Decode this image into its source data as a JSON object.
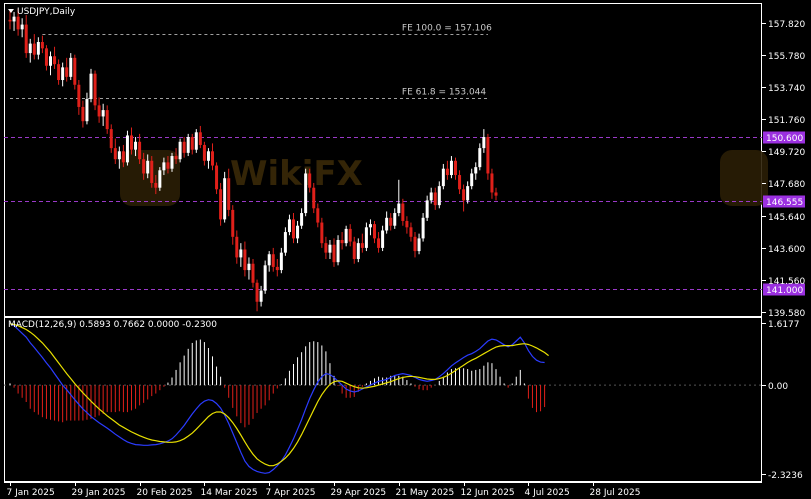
{
  "chart_data": [
    {
      "type": "candlestick",
      "title": "USDJPY,Daily",
      "title_prefix_icon": "triangle-down-icon",
      "ylim": [
        139.3,
        159.0
      ],
      "ytick_labels": [
        "157.820",
        "155.780",
        "153.740",
        "151.760",
        "149.720",
        "147.680",
        "145.640",
        "143.600",
        "141.560",
        "139.580"
      ],
      "ytick_values": [
        157.82,
        155.78,
        153.74,
        151.76,
        149.72,
        147.68,
        145.64,
        143.6,
        141.56,
        139.58
      ],
      "xtick_labels": [
        "7 Jan 2025",
        "29 Jan 2025",
        "20 Feb 2025",
        "14 Mar 2025",
        "7 Apr 2025",
        "29 Apr 2025",
        "21 May 2025",
        "12 Jun 2025",
        "4 Jul 2025",
        "28 Jul 2025"
      ],
      "xtick_index": [
        0,
        16,
        32,
        48,
        64,
        80,
        96,
        112,
        128,
        144
      ],
      "colors": {
        "bull": "#ffffff",
        "bear": "#e0201a",
        "level": "#9a39c8",
        "fib": "#a0a0a0",
        "label_bg": "#9b30e0"
      },
      "fib_levels": [
        {
          "text": "FE 100.0 = 157.106",
          "price": 157.106,
          "x_from_index": 8,
          "x_to_index": 118
        },
        {
          "text": "FE 61.8 = 153.044",
          "price": 153.044,
          "x_from_index": 0,
          "x_to_index": 118
        }
      ],
      "levels": [
        {
          "price": 150.6,
          "label": "150.600"
        },
        {
          "price": 146.555,
          "label": "146.555"
        },
        {
          "price": 141.0,
          "label": "141.000"
        }
      ],
      "ohlc": [
        [
          158.0,
          158.6,
          157.4,
          157.9
        ],
        [
          157.9,
          158.5,
          157.3,
          158.2
        ],
        [
          158.2,
          158.7,
          157.0,
          157.4
        ],
        [
          157.4,
          158.1,
          156.9,
          157.7
        ],
        [
          157.7,
          158.3,
          155.6,
          155.9
        ],
        [
          155.9,
          156.8,
          155.3,
          156.5
        ],
        [
          156.5,
          157.1,
          155.5,
          155.8
        ],
        [
          155.8,
          156.9,
          155.5,
          156.6
        ],
        [
          156.6,
          157.0,
          155.9,
          156.2
        ],
        [
          156.2,
          156.4,
          154.8,
          155.1
        ],
        [
          155.1,
          156.0,
          154.5,
          155.7
        ],
        [
          155.7,
          156.3,
          154.9,
          155.2
        ],
        [
          155.2,
          155.5,
          153.9,
          154.2
        ],
        [
          154.2,
          155.3,
          153.8,
          155.0
        ],
        [
          155.0,
          155.6,
          154.1,
          154.4
        ],
        [
          154.4,
          155.9,
          154.2,
          155.6
        ],
        [
          155.6,
          155.8,
          153.6,
          153.9
        ],
        [
          153.9,
          154.2,
          152.0,
          152.5
        ],
        [
          152.5,
          152.9,
          151.2,
          151.6
        ],
        [
          151.6,
          153.4,
          151.4,
          153.0
        ],
        [
          153.0,
          154.9,
          152.8,
          154.6
        ],
        [
          154.6,
          154.8,
          152.3,
          152.6
        ],
        [
          152.6,
          153.1,
          151.5,
          151.9
        ],
        [
          151.9,
          152.7,
          151.3,
          152.3
        ],
        [
          152.3,
          152.6,
          150.8,
          151.1
        ],
        [
          151.1,
          151.4,
          149.6,
          149.9
        ],
        [
          149.9,
          150.5,
          148.9,
          149.2
        ],
        [
          149.2,
          150.0,
          148.6,
          149.7
        ],
        [
          149.7,
          150.1,
          148.7,
          149.0
        ],
        [
          149.0,
          151.0,
          148.8,
          150.7
        ],
        [
          150.7,
          151.2,
          149.5,
          149.8
        ],
        [
          149.8,
          150.6,
          149.4,
          150.3
        ],
        [
          150.3,
          150.8,
          148.9,
          149.2
        ],
        [
          149.2,
          149.6,
          147.9,
          148.3
        ],
        [
          148.3,
          149.5,
          148.0,
          149.1
        ],
        [
          149.1,
          149.4,
          147.4,
          147.7
        ],
        [
          147.7,
          148.2,
          147.0,
          147.4
        ],
        [
          147.4,
          148.7,
          147.2,
          148.5
        ],
        [
          148.5,
          149.3,
          148.2,
          149.0
        ],
        [
          149.0,
          149.4,
          148.3,
          148.6
        ],
        [
          148.6,
          149.6,
          148.4,
          149.4
        ],
        [
          149.4,
          149.9,
          148.9,
          149.2
        ],
        [
          149.2,
          150.5,
          149.0,
          150.3
        ],
        [
          150.3,
          150.6,
          149.3,
          149.6
        ],
        [
          149.6,
          150.8,
          149.4,
          150.6
        ],
        [
          150.6,
          150.8,
          149.5,
          149.8
        ],
        [
          149.8,
          151.1,
          149.6,
          150.9
        ],
        [
          150.9,
          151.3,
          149.9,
          150.1
        ],
        [
          150.1,
          150.3,
          148.8,
          149.1
        ],
        [
          149.1,
          149.9,
          148.6,
          149.7
        ],
        [
          149.7,
          150.2,
          148.5,
          148.8
        ],
        [
          148.8,
          149.0,
          147.0,
          147.3
        ],
        [
          147.3,
          147.7,
          145.0,
          145.4
        ],
        [
          145.4,
          148.4,
          145.2,
          148.0
        ],
        [
          148.0,
          148.6,
          145.6,
          146.0
        ],
        [
          146.0,
          146.3,
          143.8,
          144.3
        ],
        [
          144.3,
          144.7,
          142.6,
          143.0
        ],
        [
          143.0,
          143.9,
          142.4,
          143.5
        ],
        [
          143.5,
          144.0,
          141.8,
          142.2
        ],
        [
          142.2,
          143.0,
          141.6,
          142.6
        ],
        [
          142.6,
          142.9,
          141.1,
          141.4
        ],
        [
          141.4,
          141.6,
          139.6,
          140.2
        ],
        [
          140.2,
          141.2,
          139.9,
          140.9
        ],
        [
          140.9,
          142.8,
          140.7,
          142.5
        ],
        [
          142.5,
          143.4,
          142.1,
          143.2
        ],
        [
          143.2,
          143.6,
          142.1,
          142.4
        ],
        [
          142.4,
          142.9,
          141.8,
          142.2
        ],
        [
          142.2,
          143.6,
          142.0,
          143.3
        ],
        [
          143.3,
          144.9,
          143.1,
          144.6
        ],
        [
          144.6,
          145.7,
          144.4,
          145.4
        ],
        [
          145.4,
          145.8,
          143.9,
          144.2
        ],
        [
          144.2,
          145.3,
          143.9,
          145.0
        ],
        [
          145.0,
          146.1,
          144.8,
          145.8
        ],
        [
          145.8,
          148.6,
          145.6,
          148.3
        ],
        [
          148.3,
          148.6,
          147.1,
          147.4
        ],
        [
          147.4,
          147.7,
          145.8,
          146.1
        ],
        [
          146.1,
          146.4,
          144.9,
          145.2
        ],
        [
          145.2,
          145.5,
          143.6,
          143.9
        ],
        [
          143.9,
          144.3,
          142.9,
          143.3
        ],
        [
          143.3,
          144.1,
          142.9,
          143.8
        ],
        [
          143.8,
          144.2,
          142.4,
          142.7
        ],
        [
          142.7,
          144.4,
          142.5,
          144.1
        ],
        [
          144.1,
          144.6,
          143.5,
          143.9
        ],
        [
          143.9,
          145.0,
          143.7,
          144.8
        ],
        [
          144.8,
          145.1,
          143.7,
          144.0
        ],
        [
          144.0,
          144.3,
          142.6,
          142.9
        ],
        [
          142.9,
          144.2,
          142.7,
          143.9
        ],
        [
          143.9,
          144.5,
          143.3,
          143.6
        ],
        [
          143.6,
          145.2,
          143.4,
          144.9
        ],
        [
          144.9,
          145.4,
          144.4,
          145.1
        ],
        [
          145.1,
          145.3,
          143.9,
          144.2
        ],
        [
          144.2,
          144.6,
          143.3,
          143.6
        ],
        [
          143.6,
          145.0,
          143.4,
          144.7
        ],
        [
          144.7,
          145.9,
          144.5,
          145.5
        ],
        [
          145.5,
          145.8,
          144.7,
          145.0
        ],
        [
          145.0,
          146.1,
          144.8,
          145.8
        ],
        [
          145.8,
          147.9,
          145.6,
          146.4
        ],
        [
          146.4,
          146.7,
          145.0,
          145.3
        ],
        [
          145.3,
          145.6,
          144.5,
          144.9
        ],
        [
          144.9,
          145.2,
          144.0,
          144.3
        ],
        [
          144.3,
          144.6,
          143.0,
          143.4
        ],
        [
          143.4,
          144.5,
          143.2,
          144.2
        ],
        [
          144.2,
          145.8,
          144.0,
          145.5
        ],
        [
          145.5,
          146.9,
          145.3,
          146.6
        ],
        [
          146.6,
          147.4,
          146.4,
          147.1
        ],
        [
          147.1,
          147.4,
          146.0,
          146.3
        ],
        [
          146.3,
          147.8,
          146.1,
          147.5
        ],
        [
          147.5,
          148.9,
          147.3,
          148.6
        ],
        [
          148.6,
          149.1,
          147.9,
          148.2
        ],
        [
          148.2,
          149.4,
          148.0,
          149.1
        ],
        [
          149.1,
          149.3,
          147.9,
          148.2
        ],
        [
          148.2,
          148.5,
          147.0,
          147.3
        ],
        [
          147.3,
          147.6,
          145.9,
          146.6
        ],
        [
          146.6,
          147.8,
          146.4,
          147.5
        ],
        [
          147.5,
          148.6,
          147.3,
          148.3
        ],
        [
          148.3,
          149.0,
          147.9,
          148.7
        ],
        [
          148.7,
          150.2,
          148.5,
          149.9
        ],
        [
          149.9,
          151.1,
          149.6,
          150.6
        ],
        [
          150.6,
          150.8,
          147.9,
          148.3
        ],
        [
          148.3,
          148.6,
          146.7,
          147.1
        ],
        [
          147.1,
          147.4,
          146.6,
          146.9
        ]
      ]
    },
    {
      "type": "line",
      "title": "MACD(12,26,9) 0.5893 0.7662 0.0000 -0.2300",
      "ylim": [
        -2.5,
        1.75
      ],
      "ytick_labels": [
        "1.6177",
        "0.00",
        "-2.3236"
      ],
      "ytick_values": [
        1.6177,
        0.0,
        -2.3236
      ],
      "colors": {
        "macd": "#2b3cff",
        "signal": "#e8e000",
        "hist_pos": "#ffffff",
        "hist_neg": "#e0201a"
      },
      "macd": [
        1.62,
        1.55,
        1.45,
        1.35,
        1.25,
        1.1,
        0.98,
        0.85,
        0.72,
        0.58,
        0.45,
        0.3,
        0.15,
        0.0,
        -0.12,
        -0.25,
        -0.38,
        -0.5,
        -0.62,
        -0.72,
        -0.82,
        -0.9,
        -0.98,
        -1.05,
        -1.12,
        -1.2,
        -1.28,
        -1.35,
        -1.42,
        -1.48,
        -1.52,
        -1.55,
        -1.56,
        -1.57,
        -1.57,
        -1.56,
        -1.55,
        -1.53,
        -1.5,
        -1.46,
        -1.4,
        -1.3,
        -1.18,
        -1.05,
        -0.9,
        -0.75,
        -0.62,
        -0.5,
        -0.42,
        -0.38,
        -0.4,
        -0.48,
        -0.6,
        -0.78,
        -1.0,
        -1.25,
        -1.5,
        -1.75,
        -1.98,
        -2.12,
        -2.2,
        -2.25,
        -2.28,
        -2.3,
        -2.28,
        -2.2,
        -2.1,
        -1.98,
        -1.82,
        -1.62,
        -1.4,
        -1.15,
        -0.9,
        -0.62,
        -0.35,
        -0.12,
        0.08,
        0.22,
        0.3,
        0.28,
        0.2,
        0.1,
        0.0,
        -0.1,
        -0.15,
        -0.18,
        -0.15,
        -0.1,
        -0.05,
        0.0,
        0.05,
        0.1,
        0.12,
        0.15,
        0.2,
        0.25,
        0.28,
        0.3,
        0.28,
        0.25,
        0.2,
        0.15,
        0.12,
        0.1,
        0.12,
        0.15,
        0.22,
        0.3,
        0.4,
        0.5,
        0.58,
        0.65,
        0.72,
        0.78,
        0.82,
        0.88,
        0.95,
        1.05,
        1.15,
        1.2,
        1.18,
        1.12,
        1.05,
        1.0,
        1.05,
        1.15,
        1.25,
        1.1,
        0.9,
        0.75,
        0.65,
        0.6,
        0.59
      ],
      "signal": [
        1.6,
        1.58,
        1.55,
        1.5,
        1.45,
        1.38,
        1.3,
        1.2,
        1.1,
        0.98,
        0.86,
        0.72,
        0.58,
        0.44,
        0.3,
        0.17,
        0.04,
        -0.08,
        -0.2,
        -0.31,
        -0.42,
        -0.52,
        -0.62,
        -0.71,
        -0.8,
        -0.88,
        -0.96,
        -1.04,
        -1.1,
        -1.16,
        -1.22,
        -1.27,
        -1.32,
        -1.36,
        -1.4,
        -1.43,
        -1.45,
        -1.47,
        -1.48,
        -1.49,
        -1.49,
        -1.48,
        -1.45,
        -1.4,
        -1.33,
        -1.25,
        -1.15,
        -1.04,
        -0.93,
        -0.82,
        -0.74,
        -0.7,
        -0.7,
        -0.75,
        -0.85,
        -0.98,
        -1.13,
        -1.3,
        -1.48,
        -1.65,
        -1.8,
        -1.92,
        -2.0,
        -2.06,
        -2.1,
        -2.1,
        -2.06,
        -1.99,
        -1.9,
        -1.79,
        -1.65,
        -1.48,
        -1.29,
        -1.08,
        -0.86,
        -0.64,
        -0.43,
        -0.25,
        -0.1,
        0.02,
        0.09,
        0.11,
        0.1,
        0.05,
        0.0,
        -0.04,
        -0.07,
        -0.08,
        -0.07,
        -0.05,
        -0.03,
        0.0,
        0.03,
        0.06,
        0.09,
        0.13,
        0.17,
        0.2,
        0.22,
        0.23,
        0.22,
        0.2,
        0.18,
        0.16,
        0.15,
        0.15,
        0.17,
        0.2,
        0.25,
        0.31,
        0.38,
        0.45,
        0.52,
        0.59,
        0.65,
        0.7,
        0.76,
        0.82,
        0.88,
        0.94,
        0.99,
        1.02,
        1.03,
        1.03,
        1.03,
        1.05,
        1.07,
        1.08,
        1.06,
        1.02,
        0.97,
        0.91,
        0.85,
        0.77
      ]
    }
  ]
}
